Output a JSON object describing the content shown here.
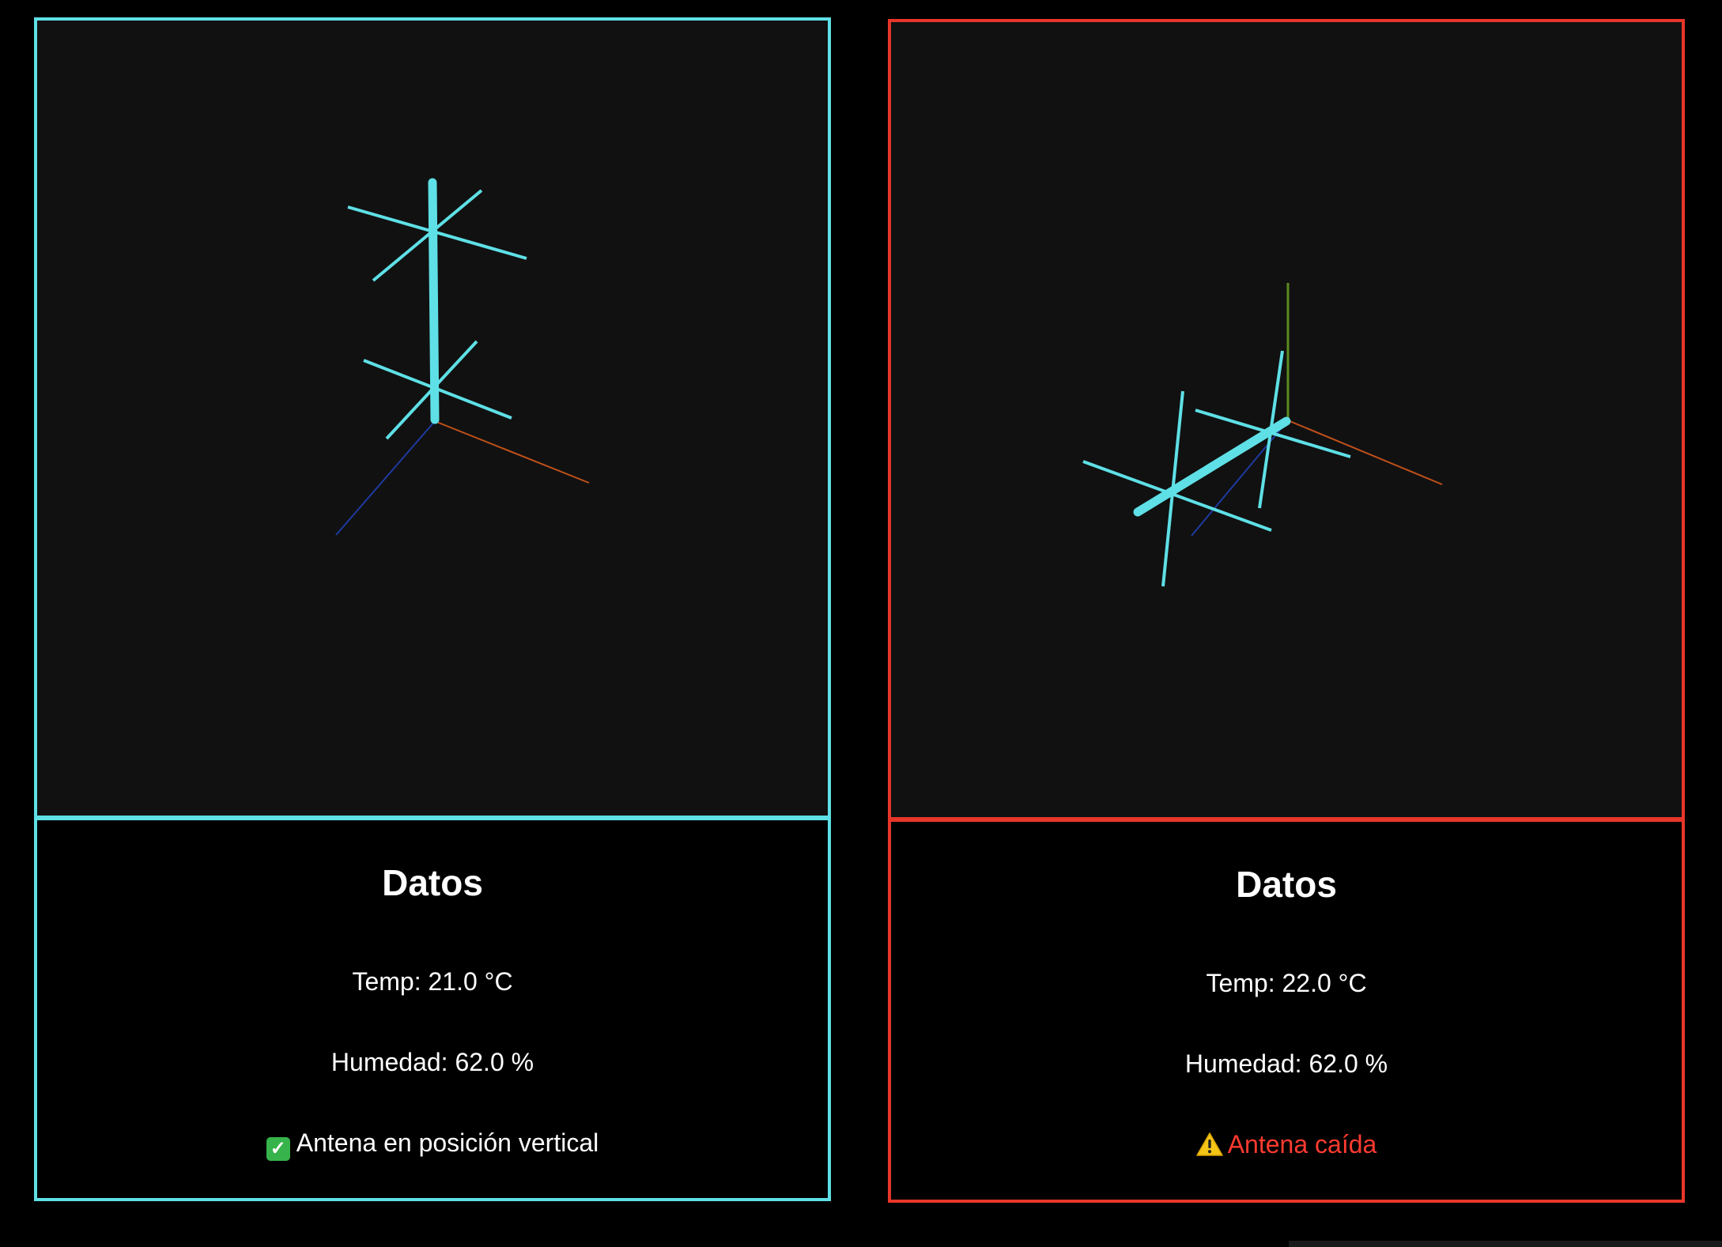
{
  "panels": [
    {
      "title": "Datos",
      "temp": "Temp: 21.0 °C",
      "humidity": "Humedad: 62.0 %",
      "status": "Antena en posición vertical",
      "status_icon": "check-icon",
      "border_color": "#5ee0e6",
      "status_color": "#ffffff"
    },
    {
      "title": "Datos",
      "temp": "Temp: 22.0 °C",
      "humidity": "Humedad: 62.0 %",
      "status": "Antena caída",
      "status_icon": "warning-icon",
      "border_color": "#e8362a",
      "status_color": "#ff3b30"
    }
  ],
  "colors": {
    "antenna": "#5ee0e6",
    "axis_x": "#c0501a",
    "axis_y": "#5a8a20",
    "axis_z": "#1e3aa0",
    "background": "#000000",
    "viewport": "#111111"
  }
}
